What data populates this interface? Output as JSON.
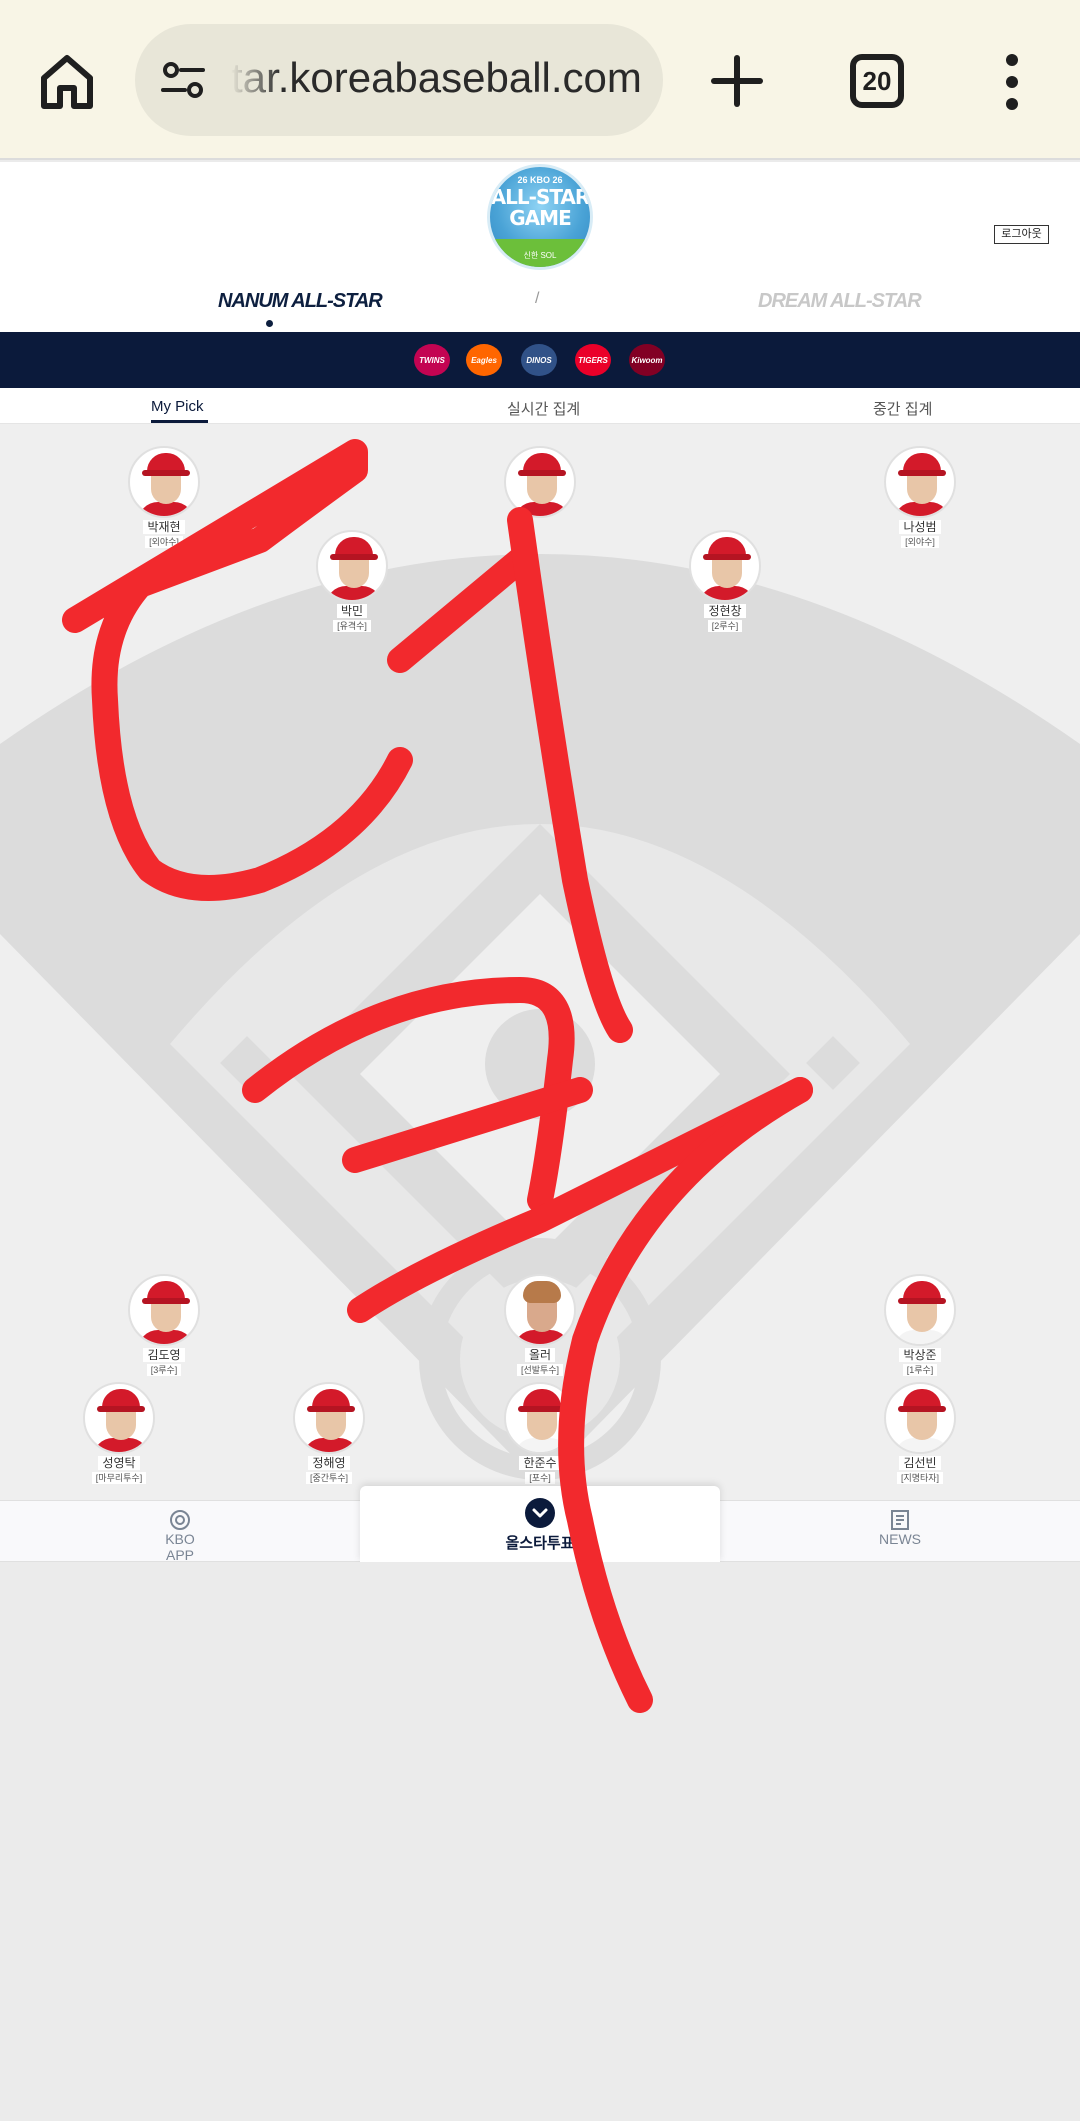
{
  "browser": {
    "url": "tar.koreabaseball.com",
    "tab_count": "20"
  },
  "header": {
    "logo_top": "26 KBO 26",
    "logo_title": "ALL-STAR GAME",
    "logo_sponsor": "신한 SOL",
    "logout_label": "로그아웃",
    "nanum_label": "NANUM ALL-STAR",
    "separator": "/",
    "dream_label": "DREAM ALL-STAR"
  },
  "teams": [
    {
      "name": "TWINS",
      "color": "#c30452"
    },
    {
      "name": "Eagles",
      "color": "#ff6600"
    },
    {
      "name": "DINOS",
      "color": "#315288"
    },
    {
      "name": "TIGERS",
      "color": "#ea0029"
    },
    {
      "name": "Kiwoom",
      "color": "#820024"
    }
  ],
  "subtabs": {
    "my_pick": "My Pick",
    "realtime": "실시간 집계",
    "interim": "중간 집계"
  },
  "players": [
    {
      "name": "박재현",
      "pos": "[외야수]"
    },
    {
      "name": "",
      "pos": ""
    },
    {
      "name": "나성범",
      "pos": "[외야수]"
    },
    {
      "name": "박민",
      "pos": "[유격수]"
    },
    {
      "name": "정현창",
      "pos": "[2루수]"
    },
    {
      "name": "김도영",
      "pos": "[3루수]"
    },
    {
      "name": "올러",
      "pos": "[선발투수]"
    },
    {
      "name": "박상준",
      "pos": "[1루수]"
    },
    {
      "name": "성영탁",
      "pos": "[마무리투수]"
    },
    {
      "name": "정해영",
      "pos": "[중간투수]"
    },
    {
      "name": "한준수",
      "pos": "[포수]"
    },
    {
      "name": "김선빈",
      "pos": "[지명타자]"
    }
  ],
  "bottom_nav": {
    "kbo_app": "KBO APP",
    "vote": "올스타투표",
    "news": "NEWS"
  },
  "colors": {
    "navy": "#0b1a3b",
    "scribble": "#f2292d",
    "chrome_bg": "#f8f5e6"
  }
}
